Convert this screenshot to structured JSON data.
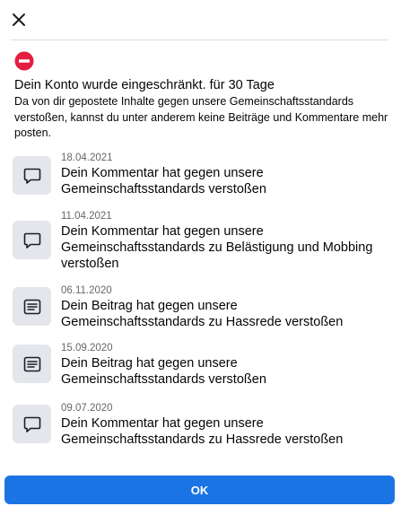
{
  "dialog": {
    "close_icon": "close-icon",
    "alert_icon": "no-entry-icon",
    "headline": "Dein Konto wurde eingeschränkt. für 30 Tage",
    "description": "Da von dir gepostete Inhalte gegen unsere Gemeinschaftsstandards verstoßen, kannst du unter anderem keine Beiträge und Kommentare mehr posten.",
    "ok_label": "OK"
  },
  "violations": [
    {
      "date": "18.04.2021",
      "title": "Dein Kommentar hat gegen unsere Gemeinschaftsstandards verstoßen",
      "icon": "comment-icon"
    },
    {
      "date": "11.04.2021",
      "title": "Dein Kommentar hat gegen unsere Gemeinschaftsstandards zu Belästigung und Mobbing verstoßen",
      "icon": "comment-icon"
    },
    {
      "date": "06.11.2020",
      "title": "Dein Beitrag hat gegen unsere Gemeinschaftsstandards zu Hassrede verstoßen",
      "icon": "post-icon"
    },
    {
      "date": "15.09.2020",
      "title": "Dein Beitrag hat gegen unsere Gemeinschaftsstandards verstoßen",
      "icon": "post-icon"
    },
    {
      "date": "09.07.2020",
      "title": "Dein Kommentar hat gegen unsere Gemeinschaftsstandards zu Hassrede verstoßen",
      "icon": "comment-icon"
    }
  ],
  "colors": {
    "primary_button": "#1b74e4",
    "alert_red": "#e41e3f",
    "icon_box_bg": "#e4e6eb",
    "secondary_text": "#65676b"
  }
}
